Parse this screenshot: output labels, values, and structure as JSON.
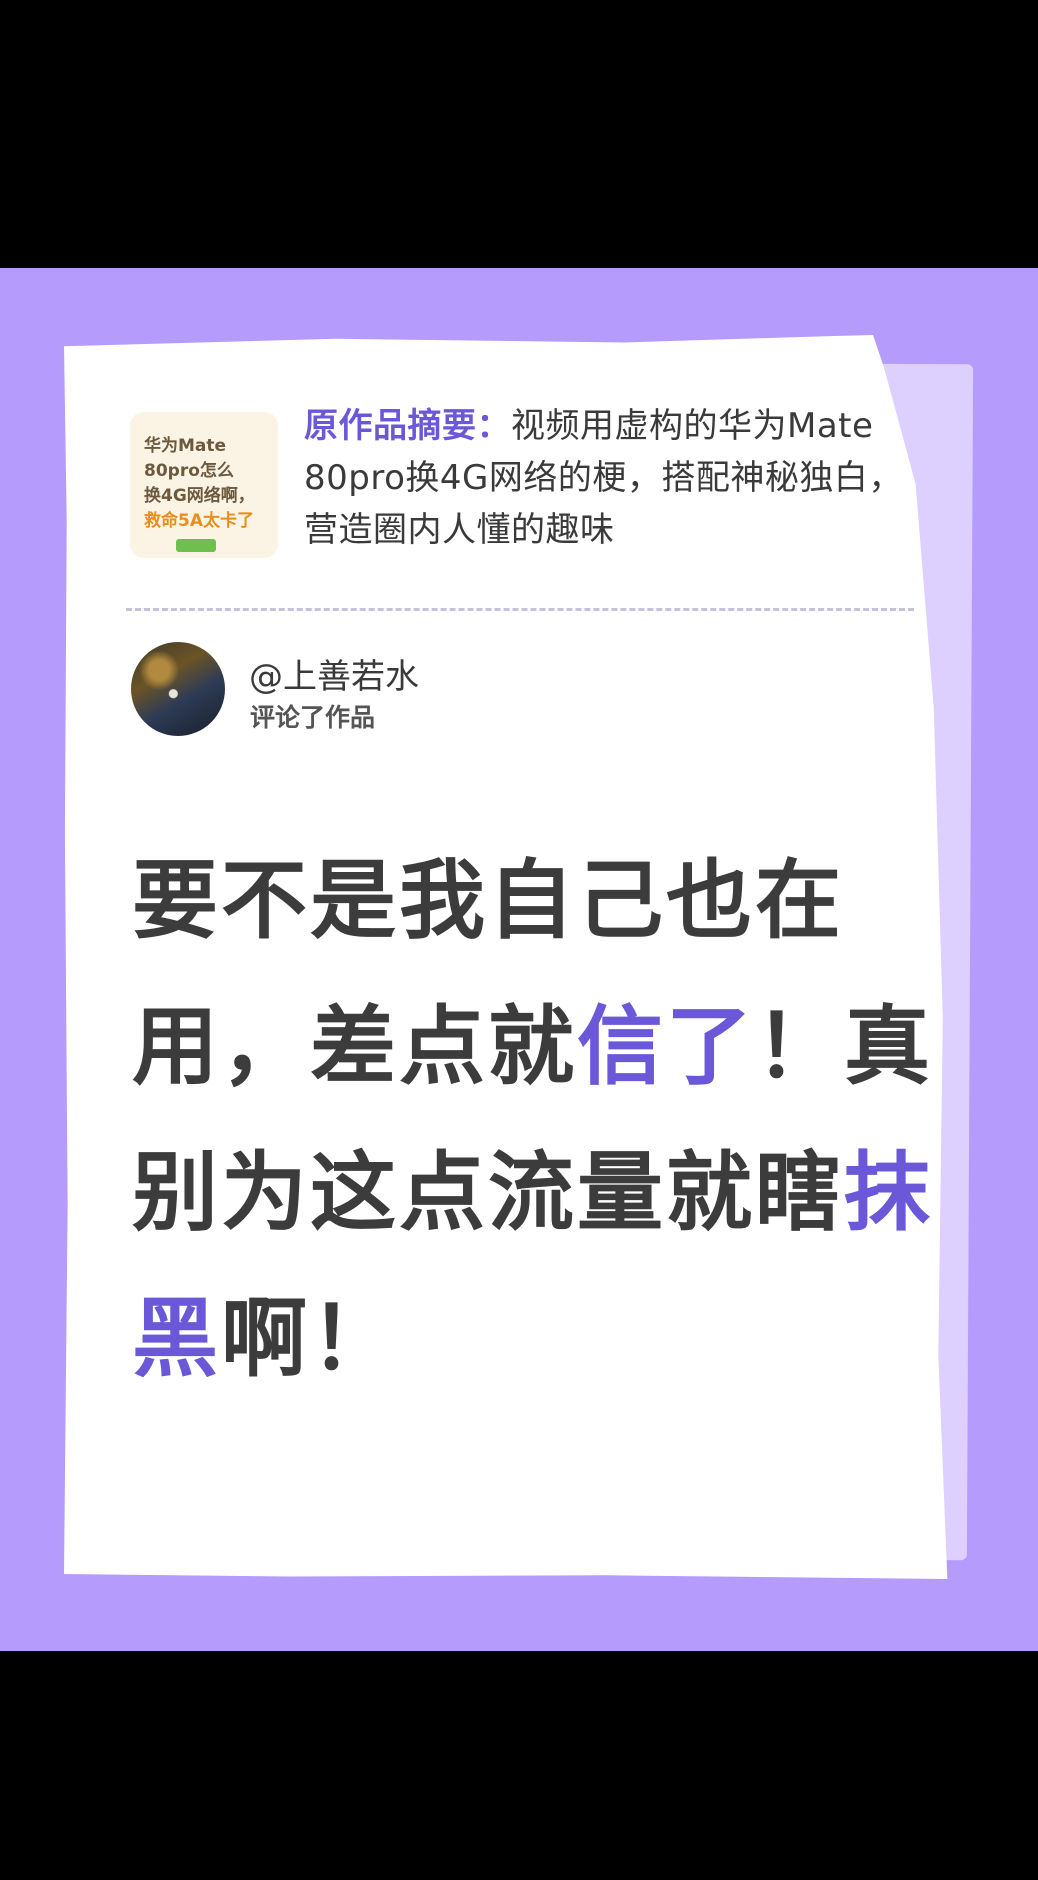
{
  "colors": {
    "background": "#b59bfb",
    "paper": "#ffffff",
    "accent": "#6a58d8",
    "text": "#3c3c3c",
    "thumbnail_bg": "#fbf3e4",
    "thumbnail_highlight": "#e88e1c"
  },
  "original_work": {
    "thumbnail": {
      "lines": [
        "华为Mate",
        "80pro怎么",
        "换4G网络啊，",
        "救命5A太卡了"
      ]
    },
    "summary_label": "原作品摘要：",
    "summary_text": "视频用虚构的华为Mate 80pro换4G网络的梗，搭配神秘独白，营造圈内人懂的趣味"
  },
  "comment": {
    "avatar_icon": "user-avatar",
    "username": "@上善若水",
    "action": "评论了作品",
    "segments": [
      {
        "text": "要不是我自己也在用，差点就",
        "accent": false
      },
      {
        "text": "信了",
        "accent": true
      },
      {
        "text": "！真别为这点流量就瞎",
        "accent": false
      },
      {
        "text": "抹黑",
        "accent": true
      },
      {
        "text": "啊！",
        "accent": false
      }
    ]
  }
}
